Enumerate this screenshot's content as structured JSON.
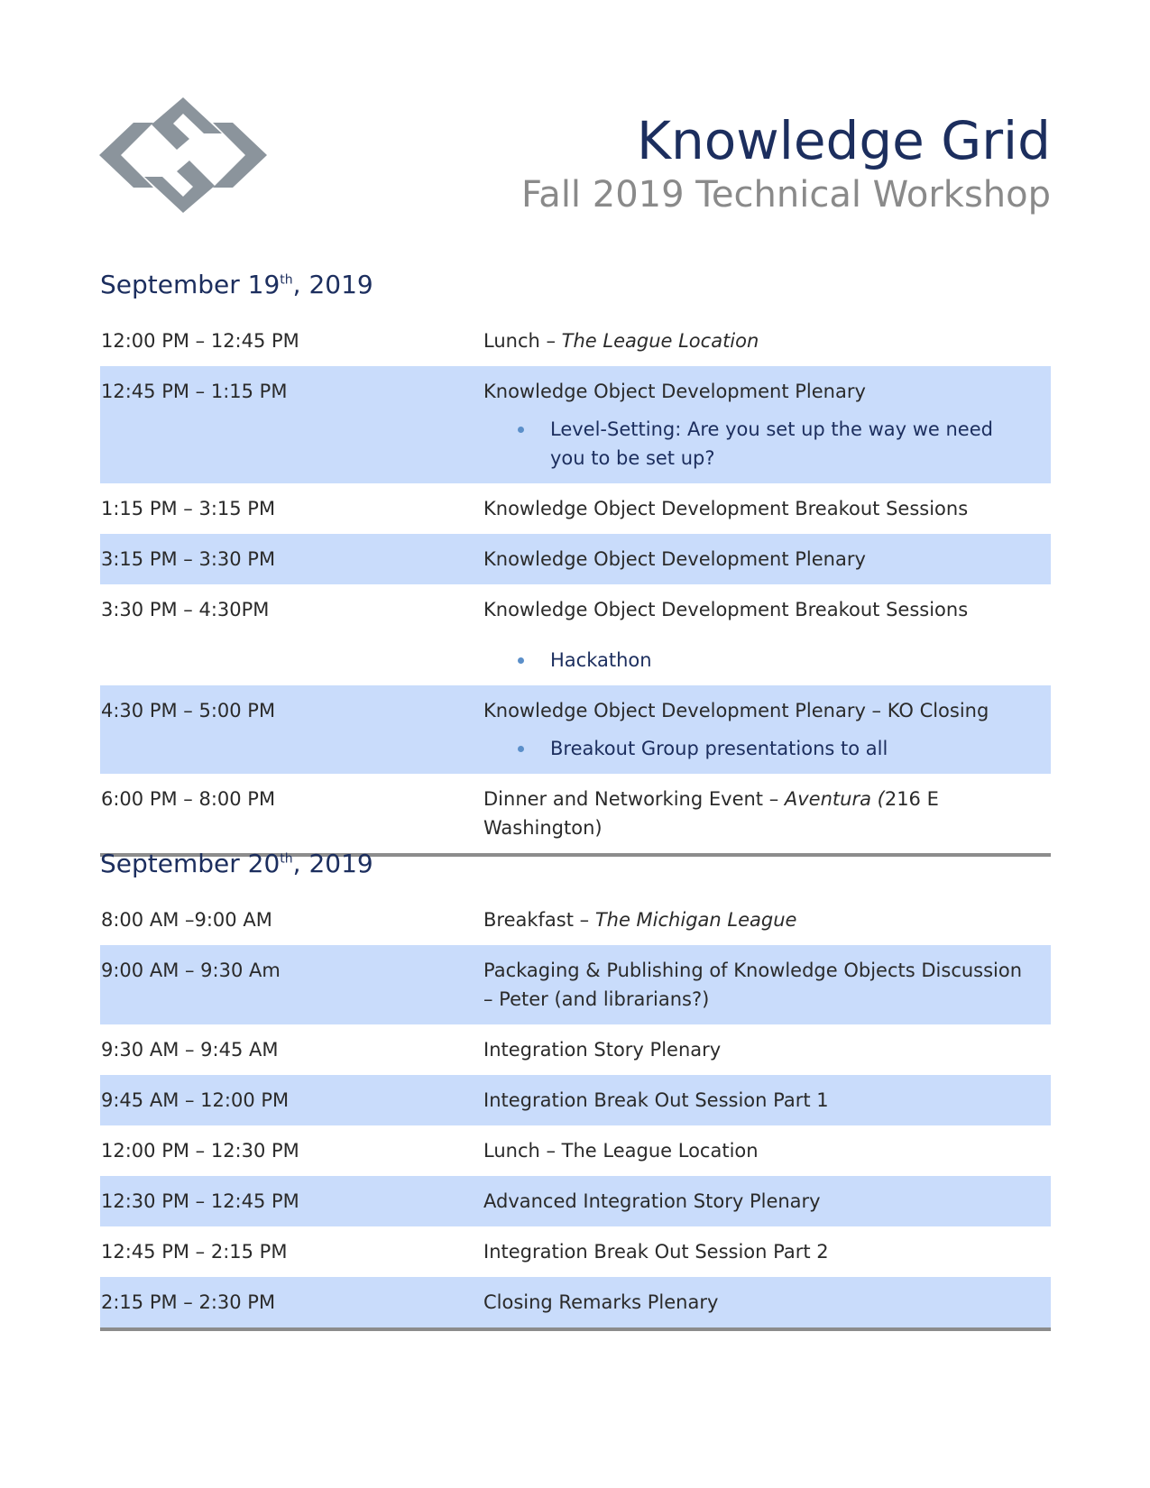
{
  "header": {
    "title": "Knowledge Grid",
    "subtitle": "Fall 2019 Technical Workshop",
    "logo_icon": "kgrid-logo-icon",
    "logo_color": "#8b949c"
  },
  "colors": {
    "heading": "#1c2e5e",
    "row_shade": "#c9dcfb",
    "rule": "#8c8c8c"
  },
  "day1": {
    "heading_prefix": "September 19",
    "heading_sup": "th",
    "heading_suffix": ", 2019",
    "rows": [
      {
        "time": "12:00 PM – 12:45 PM",
        "event_a": "Lunch – ",
        "event_em": "The League Location"
      },
      {
        "time": "12:45 PM – 1:15 PM",
        "event": "Knowledge Object Development Plenary",
        "bullet": "Level-Setting: Are you set up the way we need you to be set up?"
      },
      {
        "time": "1:15 PM – 3:15 PM",
        "event": "Knowledge Object Development Breakout Sessions"
      },
      {
        "time": "3:15 PM – 3:30 PM",
        "event": "Knowledge Object Development Plenary"
      },
      {
        "time": "3:30 PM – 4:30PM",
        "event": "Knowledge Object Development Breakout Sessions",
        "bullet": "Hackathon"
      },
      {
        "time": "4:30 PM – 5:00 PM",
        "event": "Knowledge Object Development Plenary – KO Closing",
        "bullet": "Breakout Group presentations to all"
      },
      {
        "time": "6:00 PM – 8:00 PM",
        "event_a": "Dinner and Networking Event – ",
        "event_em": "Aventura (",
        "event_b": "216 E Washington)"
      }
    ]
  },
  "day2": {
    "heading_prefix": "September 20",
    "heading_sup": "th",
    "heading_suffix": ", 2019",
    "rows": [
      {
        "time": "8:00 AM –9:00 AM",
        "event_a": "Breakfast – ",
        "event_em": "The Michigan League"
      },
      {
        "time": "9:00 AM – 9:30 Am",
        "event": "Packaging & Publishing of Knowledge Objects Discussion – Peter (and librarians?)"
      },
      {
        "time": "9:30 AM – 9:45 AM",
        "event": "Integration Story Plenary"
      },
      {
        "time": "9:45 AM – 12:00 PM",
        "event": "Integration Break Out Session Part 1"
      },
      {
        "time": "12:00 PM – 12:30 PM",
        "event_em": "Lunch – The League Location"
      },
      {
        "time": "12:30 PM – 12:45 PM",
        "event": "Advanced Integration Story Plenary"
      },
      {
        "time": "12:45 PM – 2:15 PM",
        "event": "Integration Break Out Session Part 2"
      },
      {
        "time": "2:15 PM – 2:30 PM",
        "event": "Closing Remarks Plenary"
      }
    ]
  }
}
